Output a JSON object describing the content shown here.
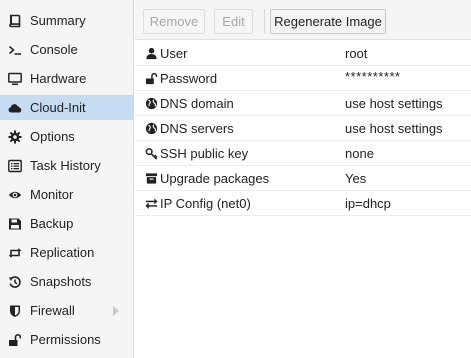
{
  "sidebar": {
    "items": [
      {
        "label": "Summary",
        "icon": "summary-book-icon"
      },
      {
        "label": "Console",
        "icon": "terminal-prompt-icon"
      },
      {
        "label": "Hardware",
        "icon": "monitor-icon"
      },
      {
        "label": "Cloud-Init",
        "icon": "cloud-icon",
        "active": true
      },
      {
        "label": "Options",
        "icon": "gear-icon"
      },
      {
        "label": "Task History",
        "icon": "list-alt-icon"
      },
      {
        "label": "Monitor",
        "icon": "eye-icon"
      },
      {
        "label": "Backup",
        "icon": "floppy-disk-icon"
      },
      {
        "label": "Replication",
        "icon": "retweet-icon"
      },
      {
        "label": "Snapshots",
        "icon": "history-icon"
      },
      {
        "label": "Firewall",
        "icon": "shield-icon",
        "expandable": true
      },
      {
        "label": "Permissions",
        "icon": "unlock-icon"
      }
    ]
  },
  "toolbar": {
    "remove_label": "Remove",
    "edit_label": "Edit",
    "regenerate_label": "Regenerate Image"
  },
  "settings": [
    {
      "key": "User",
      "value": "root",
      "icon": "user-icon"
    },
    {
      "key": "Password",
      "value": "**********",
      "icon": "unlock-icon"
    },
    {
      "key": "DNS domain",
      "value": "use host settings",
      "icon": "globe-icon"
    },
    {
      "key": "DNS servers",
      "value": "use host settings",
      "icon": "globe-icon"
    },
    {
      "key": "SSH public key",
      "value": "none",
      "icon": "key-icon"
    },
    {
      "key": "Upgrade packages",
      "value": "Yes",
      "icon": "archive-icon"
    },
    {
      "key": "IP Config (net0)",
      "value": "ip=dhcp",
      "icon": "exchange-icon"
    }
  ],
  "colors": {
    "sidebar_bg": "#f5f5f5",
    "active_bg": "#c5dcf3",
    "disabled_text": "#a8a8a8"
  }
}
